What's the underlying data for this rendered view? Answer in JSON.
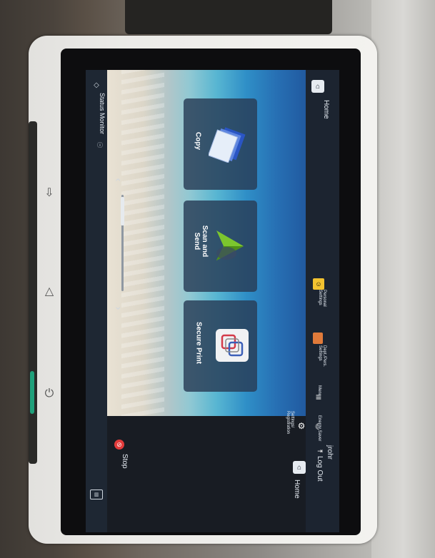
{
  "screen": {
    "home_header": "Home",
    "status_monitor": "Status Monitor",
    "stop": "Stop",
    "tiles": [
      {
        "label": "Copy",
        "icon": "copy-icon"
      },
      {
        "label": "Scan and Send",
        "icon": "scan-send-icon"
      },
      {
        "label": "Secure Print",
        "icon": "secure-print-icon"
      }
    ],
    "top_bar": {
      "personal_settings": "Personal Settings",
      "dept_settings": "Dept./Pers. Settings",
      "menu": "Menu",
      "energy_saver": "Energy Saver",
      "settings_registration": "Settings/ Registration",
      "user": "jrohr",
      "log_out": "Log Out",
      "home": "Home"
    }
  },
  "colors": {
    "stop": "#e23b3b",
    "led": "#1fa07a"
  }
}
